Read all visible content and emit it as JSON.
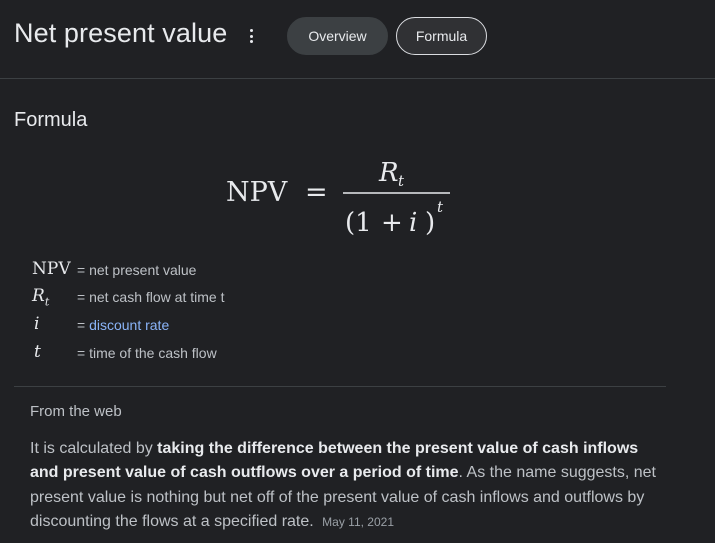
{
  "header": {
    "title": "Net present value",
    "tabs": [
      {
        "label": "Overview"
      },
      {
        "label": "Formula"
      }
    ]
  },
  "formula_section": {
    "heading": "Formula",
    "equation": {
      "lhs": "NPV",
      "equals": "=",
      "numerator_symbol": "R",
      "numerator_subscript": "t",
      "denominator_open": "(1",
      "denominator_plus": "+",
      "denominator_var": "i",
      "denominator_close": ")",
      "denominator_exponent": "t"
    },
    "legend": [
      {
        "symbol": "NPV",
        "definition": "= net present value"
      },
      {
        "symbol": "R",
        "subscript": "t",
        "definition": "= net cash flow at time t"
      },
      {
        "symbol": "i",
        "definition_prefix": "= ",
        "definition_link": "discount rate"
      },
      {
        "symbol": "t",
        "definition": "= time of the cash flow"
      }
    ]
  },
  "web_section": {
    "label": "From the web",
    "snippet_start": "It is calculated by ",
    "snippet_bold": "taking the difference between the present value of cash inflows and present value of cash outflows over a period of time",
    "snippet_end": ". As the name suggests, net present value is nothing but net off of the present value of cash inflows and outflows by discounting the flows at a specified rate.",
    "date": "May 11, 2021"
  },
  "colors": {
    "background": "#202124",
    "text_primary": "#e8eaed",
    "text_secondary": "#bdc1c6",
    "link": "#8ab4f8",
    "chip_fill": "#3c4043"
  },
  "icons": {
    "more_options": "more-vert-icon"
  }
}
